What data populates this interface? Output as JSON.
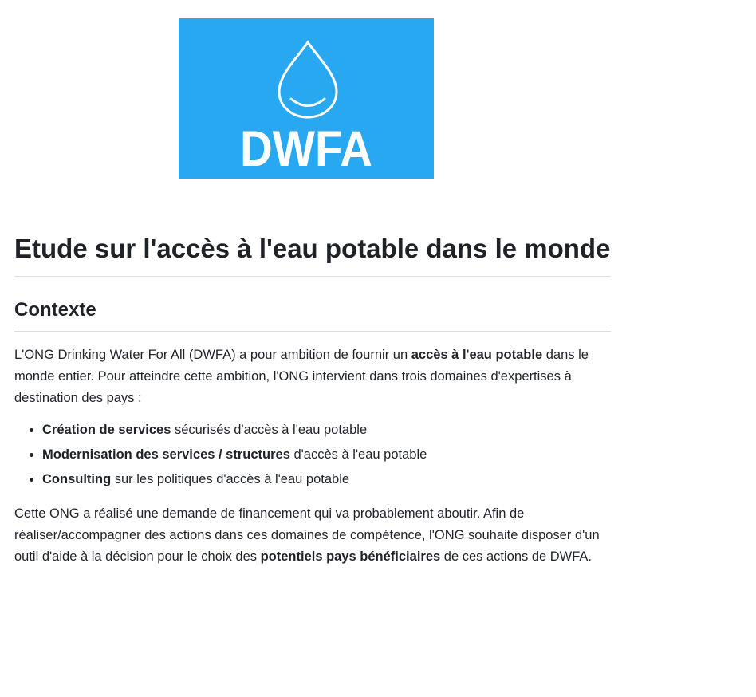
{
  "logo": {
    "text": "DWFA",
    "background": "#27a8f0",
    "icon": "water-drop-icon"
  },
  "title": "Etude sur l'accès à l'eau potable dans le monde",
  "section": "Contexte",
  "intro": {
    "part1": "L'ONG Drinking Water For All (DWFA) a pour ambition de fournir un ",
    "bold1": "accès à l'eau potable",
    "part2": " dans le monde entier. Pour atteindre cette ambition, l'ONG intervient dans trois domaines d'expertises à destination des pays :"
  },
  "domains": [
    {
      "bold": "Création de services",
      "rest": " sécurisés d'accès à l'eau potable"
    },
    {
      "bold": "Modernisation des services / structures",
      "rest": " d'accès à l'eau potable"
    },
    {
      "bold": "Consulting",
      "rest": " sur les politiques d'accès à l'eau potable"
    }
  ],
  "closing": {
    "part1": "Cette ONG a réalisé une demande de financement qui va probablement aboutir. Afin de réaliser/accompagner des actions dans ces domaines de compétence, l'ONG souhaite disposer d'un outil d'aide à la décision pour le choix des ",
    "bold1": "potentiels pays bénéficiaires",
    "part2": " de ces actions de DWFA."
  }
}
